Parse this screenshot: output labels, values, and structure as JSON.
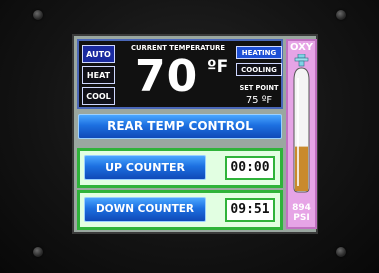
{
  "controls": {
    "mode_buttons": [
      "AUTO",
      "HEAT",
      "COOL"
    ],
    "current_temp_label": "CURRENT TEMPERATURE",
    "current_temp_value": "70",
    "temp_unit": "ºF",
    "status_buttons": [
      "HEATING",
      "COOLING"
    ],
    "setpoint_label": "SET POINT",
    "setpoint_value": "75 ºF"
  },
  "rear_temp_button": "REAR TEMP CONTROL",
  "up_counter": {
    "label": "UP COUNTER",
    "value": "00:00"
  },
  "down_counter": {
    "label": "DOWN COUNTER",
    "value": "09:51"
  },
  "oxy": {
    "title": "OXY",
    "psi_value": "894",
    "psi_unit": "PSI",
    "level_fraction": 0.4
  },
  "colors": {
    "screen_bg": "#9aa7a0",
    "button_blue": "#1c6fe0",
    "panel_green": "#2fb33a",
    "oxy_pink": "#e6a4e6",
    "tank_fill": "#c98a2c"
  }
}
